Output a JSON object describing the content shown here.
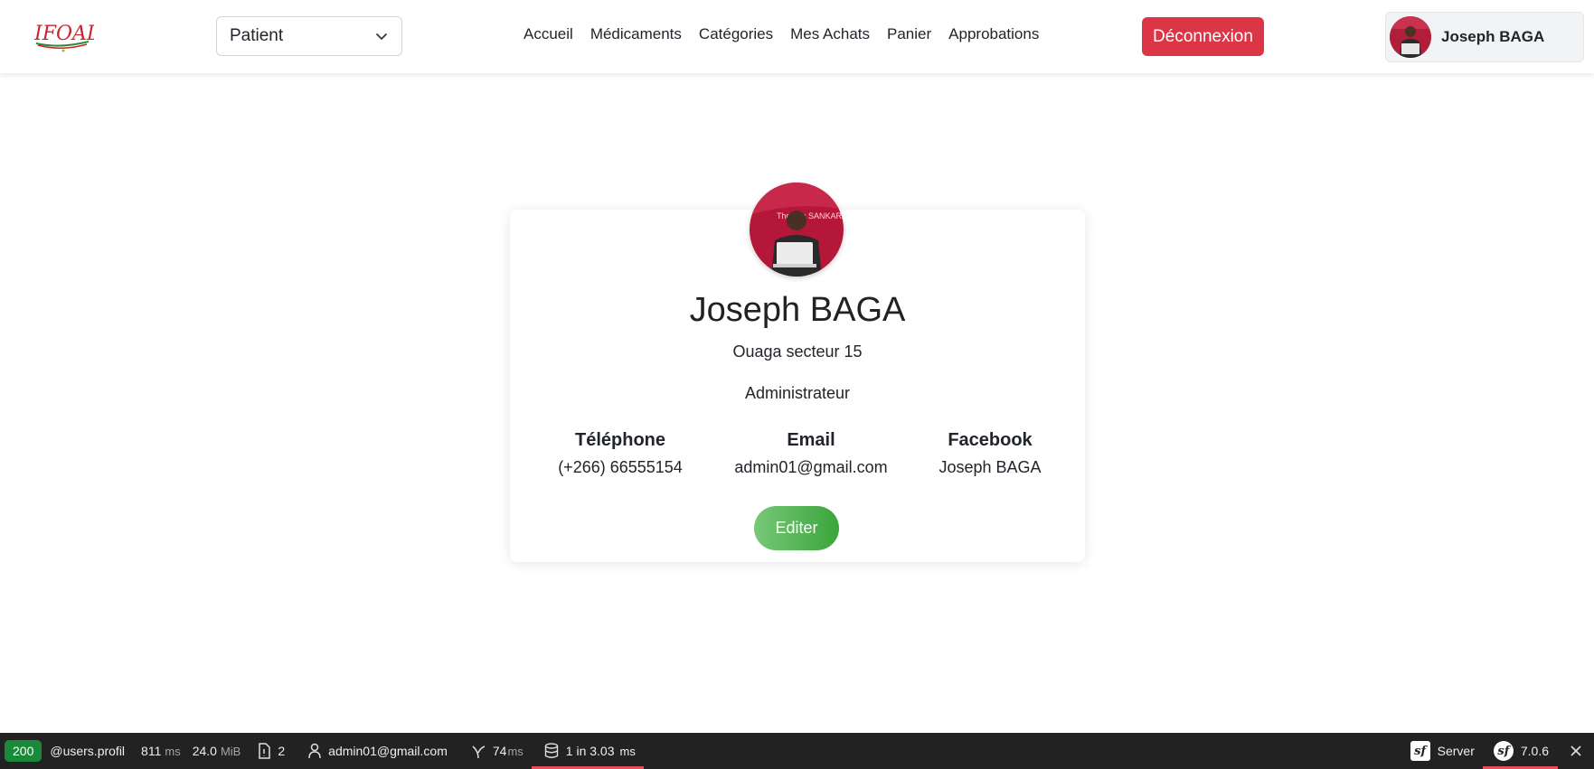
{
  "header": {
    "logo_text": "IFOAD",
    "role_select": {
      "value": "Patient"
    },
    "nav": [
      {
        "label": "Accueil"
      },
      {
        "label": "Médicaments"
      },
      {
        "label": "Catégories"
      },
      {
        "label": "Mes Achats"
      },
      {
        "label": "Panier"
      },
      {
        "label": "Approbations"
      }
    ],
    "logout_label": "Déconnexion",
    "user_name": "Joseph BAGA"
  },
  "profile": {
    "name": "Joseph BAGA",
    "address": "Ouaga secteur 15",
    "role": "Administrateur",
    "phone_label": "Téléphone",
    "phone_value": "(+266) 66555154",
    "email_label": "Email",
    "email_value": "admin01@gmail.com",
    "facebook_label": "Facebook",
    "facebook_value": "Joseph BAGA",
    "edit_label": "Editer",
    "photo_caption": "Thomas SANKARA"
  },
  "toolbar": {
    "status_code": "200",
    "route": "@users.profil",
    "time_value": "811",
    "time_unit": "ms",
    "memory_value": "24.0",
    "memory_unit": "MiB",
    "files_count": "2",
    "user": "admin01@gmail.com",
    "twig_value": "74",
    "twig_unit": "ms",
    "db_value": "1 in 3.03",
    "db_unit": "ms",
    "server_label": "Server",
    "version": "7.0.6"
  },
  "colors": {
    "danger": "#dc3545",
    "success_start": "#78c878",
    "success_end": "#3aa53a",
    "toolbar_bg": "#222222",
    "status_green": "#1a8a3a"
  }
}
